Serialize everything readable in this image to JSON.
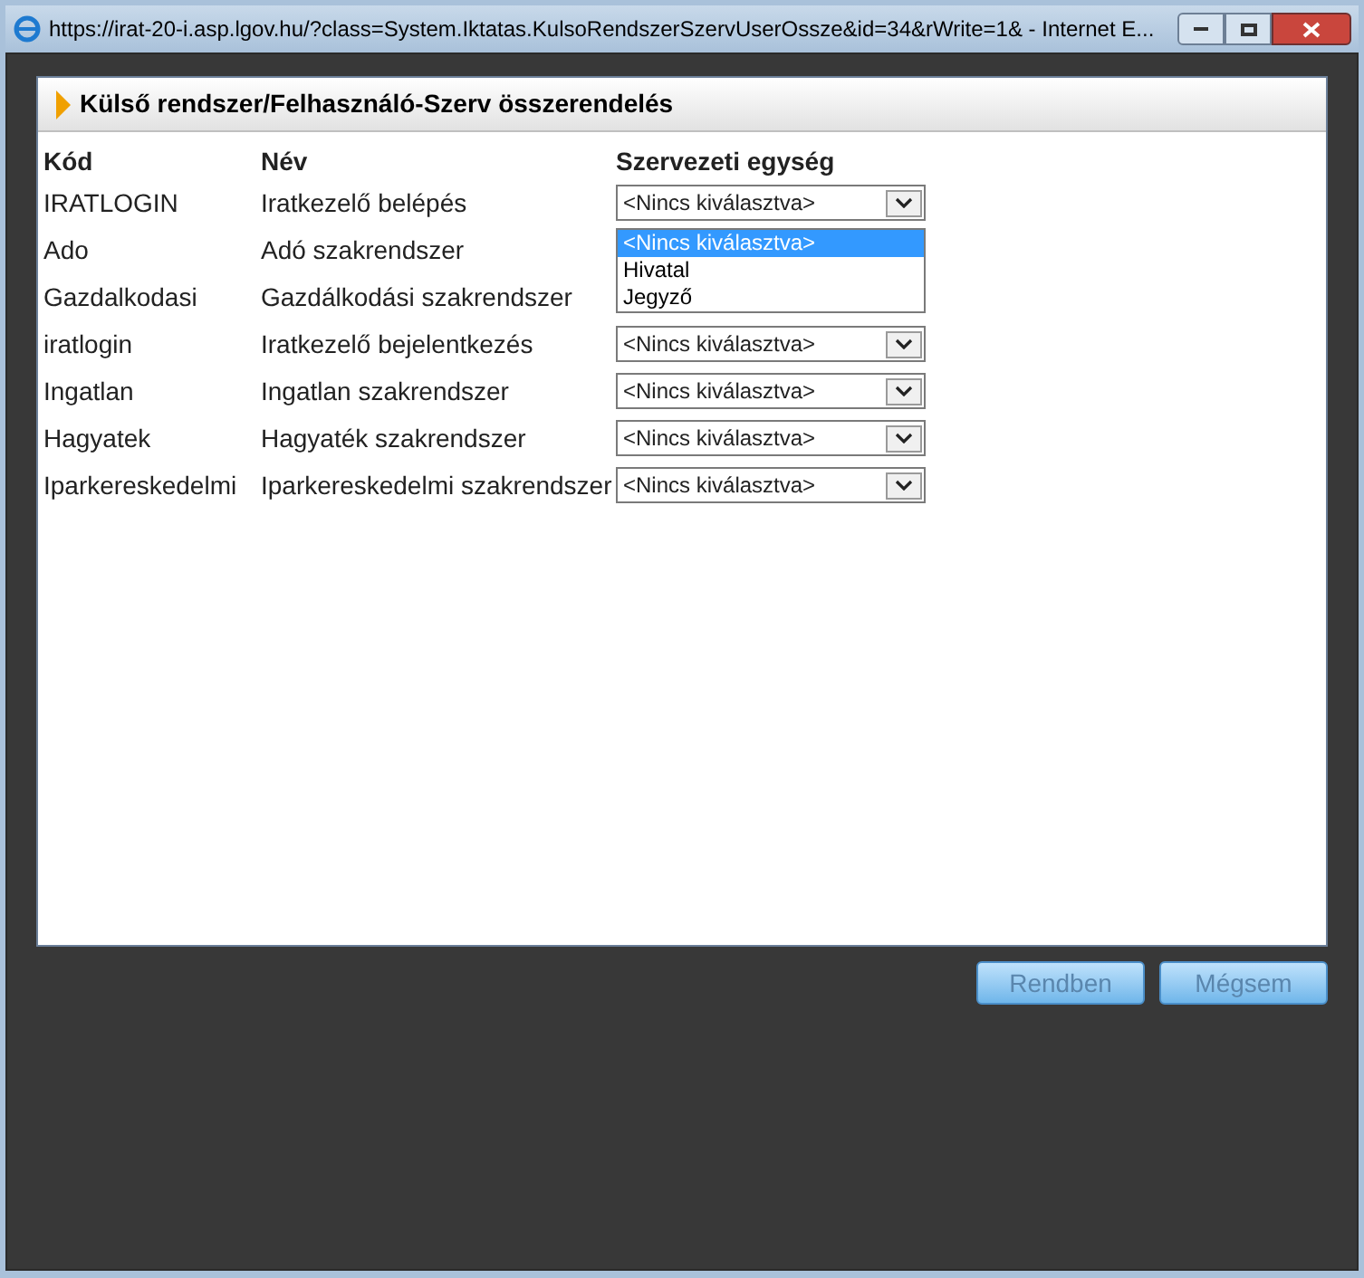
{
  "window": {
    "title": "https://irat-20-i.asp.lgov.hu/?class=System.Iktatas.KulsoRendszerSzervUserOssze&id=34&rWrite=1& - Internet E..."
  },
  "panel": {
    "title": "Külső rendszer/Felhasználó-Szerv összerendelés"
  },
  "table": {
    "columns": [
      "Kód",
      "Név",
      "Szervezeti egység"
    ],
    "rows": [
      {
        "code": "IRATLOGIN",
        "name": "Iratkezelő belépés",
        "select": {
          "value": "<Nincs kiválasztva>",
          "open": false
        }
      },
      {
        "code": "Ado",
        "name": "Adó szakrendszer",
        "select": {
          "open": true,
          "options": [
            {
              "label": "<Nincs kiválasztva>",
              "selected": true
            },
            {
              "label": "Hivatal",
              "selected": false
            },
            {
              "label": "Jegyző",
              "selected": false
            }
          ]
        }
      },
      {
        "code": "Gazdalkodasi",
        "name": "Gazdálkodási szakrendszer"
      },
      {
        "code": "iratlogin",
        "name": "Iratkezelő bejelentkezés",
        "select": {
          "value": "<Nincs kiválasztva>",
          "open": false
        }
      },
      {
        "code": "Ingatlan",
        "name": "Ingatlan szakrendszer",
        "select": {
          "value": "<Nincs kiválasztva>",
          "open": false
        }
      },
      {
        "code": "Hagyatek",
        "name": "Hagyaték szakrendszer",
        "select": {
          "value": "<Nincs kiválasztva>",
          "open": false
        }
      },
      {
        "code": "Iparkereskedelmi",
        "name": "Iparkereskedelmi szakrendszer",
        "select": {
          "value": "<Nincs kiválasztva>",
          "open": false
        }
      }
    ]
  },
  "buttons": [
    {
      "label": "Rendben",
      "disabled": true
    },
    {
      "label": "Mégsem",
      "disabled": true
    }
  ]
}
